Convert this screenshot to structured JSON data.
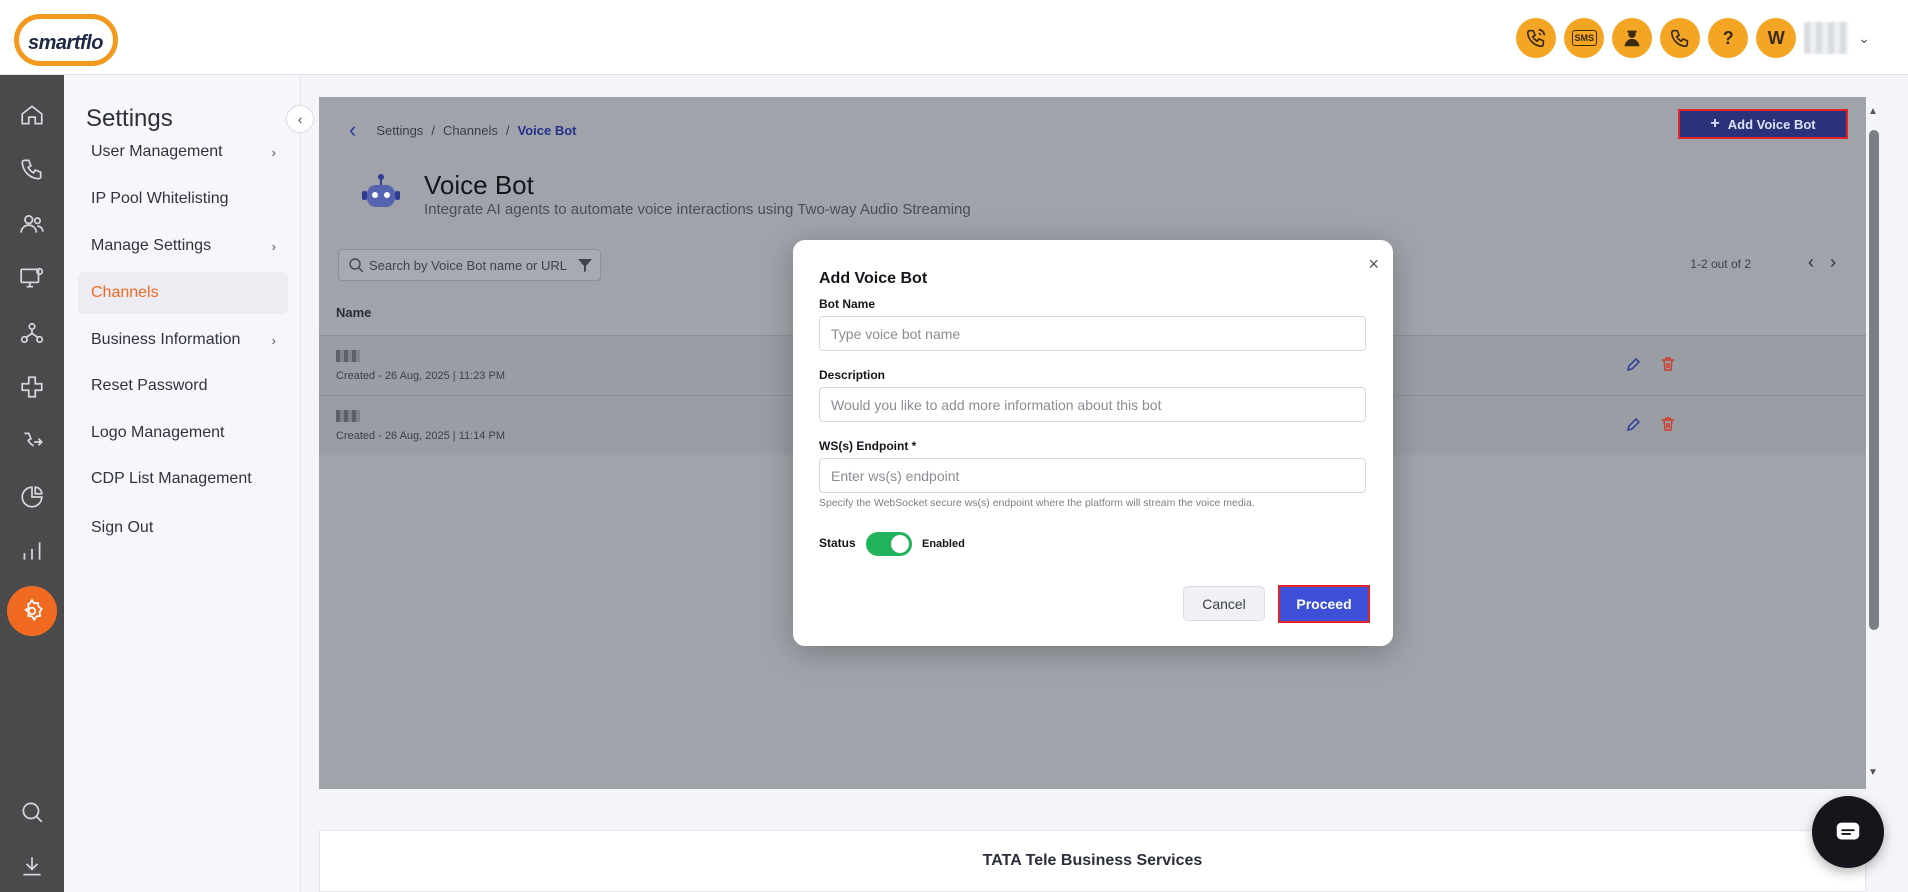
{
  "brand": {
    "logo_text": "smartflo",
    "accent": "#f06a22",
    "topicon_color": "#f5a524"
  },
  "topbar": {
    "icons": [
      "call-icon",
      "sms-icon",
      "agent-icon",
      "call-support-icon",
      "help-icon"
    ],
    "sms_label": "SMS",
    "help_label": "?",
    "user_initial": "W"
  },
  "rail": {
    "icons": [
      "home-icon",
      "phone-icon",
      "users-icon",
      "monitor-settings-icon",
      "network-icon",
      "integration-icon",
      "routing-icon",
      "pie-chart-icon",
      "bar-chart-icon",
      "settings-icon",
      "search-icon",
      "download-icon"
    ],
    "active": "settings-icon"
  },
  "sidebar": {
    "title": "Settings",
    "items": [
      {
        "label": "User Management",
        "has_children": true
      },
      {
        "label": "IP Pool Whitelisting",
        "has_children": false
      },
      {
        "label": "Manage Settings",
        "has_children": true
      },
      {
        "label": "Channels",
        "has_children": false,
        "active": true
      },
      {
        "label": "Business Information",
        "has_children": true
      },
      {
        "label": "Reset Password",
        "has_children": false
      },
      {
        "label": "Logo Management",
        "has_children": false
      },
      {
        "label": "CDP List Management",
        "has_children": false
      },
      {
        "label": "Sign Out",
        "has_children": false
      }
    ]
  },
  "breadcrumb": {
    "items": [
      "Settings",
      "Channels",
      "Voice Bot"
    ],
    "separator": "/"
  },
  "page": {
    "add_button_label": "Add Voice Bot",
    "title": "Voice Bot",
    "subtitle": "Integrate AI agents to automate voice interactions using Two-way Audio Streaming",
    "search_placeholder": "Search by Voice Bot name or URL",
    "pager_text": "1-2 out of 2",
    "column_name": "Name",
    "rows": [
      {
        "created": "Created - 26 Aug, 2025 | 11:23 PM"
      },
      {
        "created": "Created - 26 Aug, 2025 | 11:14 PM"
      }
    ]
  },
  "modal": {
    "title": "Add Voice Bot",
    "close_label": "×",
    "bot_name_label": "Bot Name",
    "bot_name_placeholder": "Type voice bot name",
    "description_label": "Description",
    "description_placeholder": "Would you like to add more information about this bot",
    "endpoint_label": "WS(s) Endpoint *",
    "endpoint_placeholder": "Enter ws(s) endpoint",
    "endpoint_hint": "Specify the WebSocket secure ws(s) endpoint where the platform will stream the voice media.",
    "status_label": "Status",
    "status_value": "Enabled",
    "cancel_label": "Cancel",
    "proceed_label": "Proceed"
  },
  "footer": {
    "text": "TATA Tele Business Services"
  }
}
